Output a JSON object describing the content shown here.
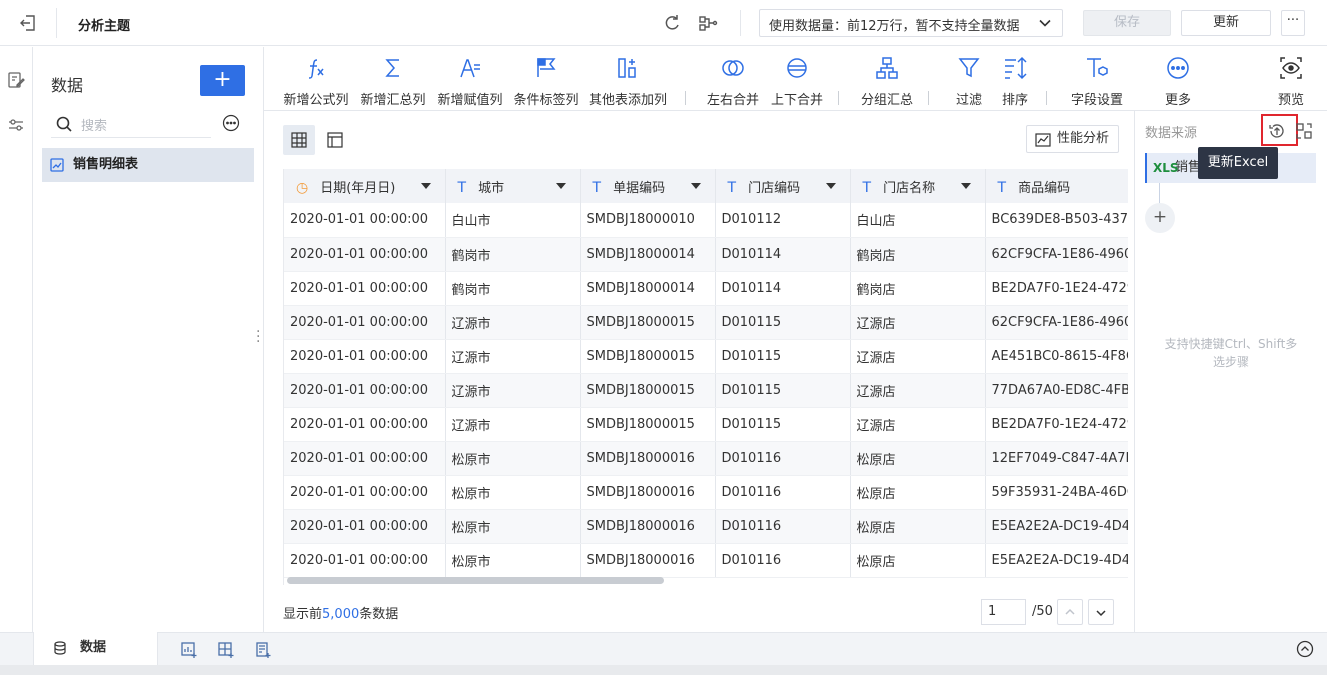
{
  "header": {
    "title": "分析主题",
    "data_usage": "使用数据量：前12万行，暂不支持全量数据",
    "save_label": "保存",
    "update_label": "更新",
    "more_label": "···"
  },
  "data_panel": {
    "title": "数据",
    "add_label": "+",
    "search_placeholder": "搜索",
    "item_label": "销售明细表"
  },
  "toolbar": {
    "items": [
      {
        "label": "新增公式列",
        "icon": "formula-icon"
      },
      {
        "label": "新增汇总列",
        "icon": "sigma-icon"
      },
      {
        "label": "新增赋值列",
        "icon": "assign-icon"
      },
      {
        "label": "条件标签列",
        "icon": "flag-icon"
      },
      {
        "label": "其他表添加列",
        "icon": "add-column-icon"
      },
      {
        "label": "左右合并",
        "icon": "merge-horizontal-icon"
      },
      {
        "label": "上下合并",
        "icon": "merge-vertical-icon"
      },
      {
        "label": "分组汇总",
        "icon": "group-icon"
      },
      {
        "label": "过滤",
        "icon": "filter-icon"
      },
      {
        "label": "排序",
        "icon": "sort-icon"
      },
      {
        "label": "字段设置",
        "icon": "field-settings-icon"
      },
      {
        "label": "更多",
        "icon": "more-icon"
      },
      {
        "label": "预览",
        "icon": "preview-icon"
      }
    ]
  },
  "main": {
    "perf_label": "性能分析",
    "columns": [
      "日期(年月日)",
      "城市",
      "单据编码",
      "门店编码",
      "门店名称",
      "商品编码"
    ],
    "rows": [
      [
        "2020-01-01 00:00:00",
        "白山市",
        "SMDBJ18000010",
        "D010112",
        "白山店",
        "BC639DE8-B503-437C"
      ],
      [
        "2020-01-01 00:00:00",
        "鹤岗市",
        "SMDBJ18000014",
        "D010114",
        "鹤岗店",
        "62CF9CFA-1E86-4960"
      ],
      [
        "2020-01-01 00:00:00",
        "鹤岗市",
        "SMDBJ18000014",
        "D010114",
        "鹤岗店",
        "BE2DA7F0-1E24-4729"
      ],
      [
        "2020-01-01 00:00:00",
        "辽源市",
        "SMDBJ18000015",
        "D010115",
        "辽源店",
        "62CF9CFA-1E86-4960"
      ],
      [
        "2020-01-01 00:00:00",
        "辽源市",
        "SMDBJ18000015",
        "D010115",
        "辽源店",
        "AE451BC0-8615-4F8C"
      ],
      [
        "2020-01-01 00:00:00",
        "辽源市",
        "SMDBJ18000015",
        "D010115",
        "辽源店",
        "77DA67A0-ED8C-4FB3"
      ],
      [
        "2020-01-01 00:00:00",
        "辽源市",
        "SMDBJ18000015",
        "D010115",
        "辽源店",
        "BE2DA7F0-1E24-4729"
      ],
      [
        "2020-01-01 00:00:00",
        "松原市",
        "SMDBJ18000016",
        "D010116",
        "松原店",
        "12EF7049-C847-4A7F"
      ],
      [
        "2020-01-01 00:00:00",
        "松原市",
        "SMDBJ18000016",
        "D010116",
        "松原店",
        "59F35931-24BA-46DC"
      ],
      [
        "2020-01-01 00:00:00",
        "松原市",
        "SMDBJ18000016",
        "D010116",
        "松原店",
        "E5EA2E2A-DC19-4D4"
      ],
      [
        "2020-01-01 00:00:00",
        "松原市",
        "SMDBJ18000016",
        "D010116",
        "松原店",
        "E5EA2E2A-DC19-4D4"
      ]
    ],
    "footer_prefix": "显示前",
    "footer_count": "5,000",
    "footer_suffix": "条数据",
    "page_current": "1",
    "page_total": "/50"
  },
  "right_panel": {
    "title": "数据来源",
    "source_label": "销售",
    "source_badge": "XLS",
    "tooltip": "更新Excel",
    "hint": "支持快捷键Ctrl、Shift多选步骤"
  },
  "bottom": {
    "tab_label": "数据"
  },
  "colors": {
    "accent": "#2f6fe4",
    "highlight": "#e0262e"
  }
}
